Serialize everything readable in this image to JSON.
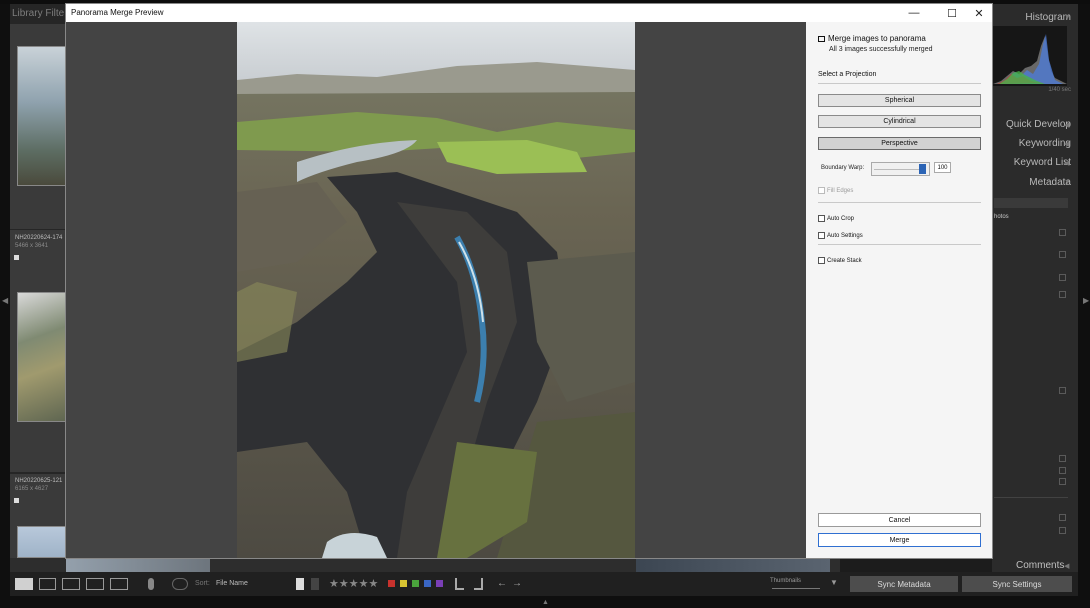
{
  "app": {
    "library_filter": "Library Filte",
    "left_cells": [
      {
        "name": "NH20220624-174",
        "dims": "5466 x 3641"
      },
      {
        "name": "NH20220625-121",
        "dims": "6165 x 4627"
      }
    ],
    "right_panel": {
      "histogram": "Histogram",
      "hist_info": "1/40 sec",
      "quick_develop": "Quick Develop",
      "keywording": "Keywording",
      "keyword_list": "Keyword List",
      "metadata": "Metadata",
      "photos_fragment": "hotos",
      "comments": "Comments"
    },
    "toolbar": {
      "sort_label": "Sort:",
      "sort_value": "File Name",
      "thumbnails_label": "Thumbnails",
      "rating_stars": "★★★★★",
      "sync_metadata": "Sync Metadata",
      "sync_settings": "Sync Settings"
    },
    "color_labels": [
      "#c8322d",
      "#d7c332",
      "#4aa33c",
      "#3a66c4",
      "#7a3fb6"
    ]
  },
  "dialog": {
    "title": "Panorama Merge Preview",
    "controls": {
      "minimize": "—",
      "maximize": "☐",
      "close": "✕"
    },
    "panel": {
      "heading": "Merge images to panorama",
      "status": "All 3 images successfully merged",
      "projection_label": "Select a Projection",
      "projections": [
        "Spherical",
        "Cylindrical",
        "Perspective"
      ],
      "selected_projection": "Perspective",
      "boundary_warp_label": "Boundary Warp:",
      "boundary_warp_value": "100",
      "fill_edges": "Fill Edges",
      "auto_crop": "Auto Crop",
      "auto_settings": "Auto Settings",
      "create_stack": "Create Stack",
      "cancel": "Cancel",
      "merge": "Merge"
    }
  }
}
